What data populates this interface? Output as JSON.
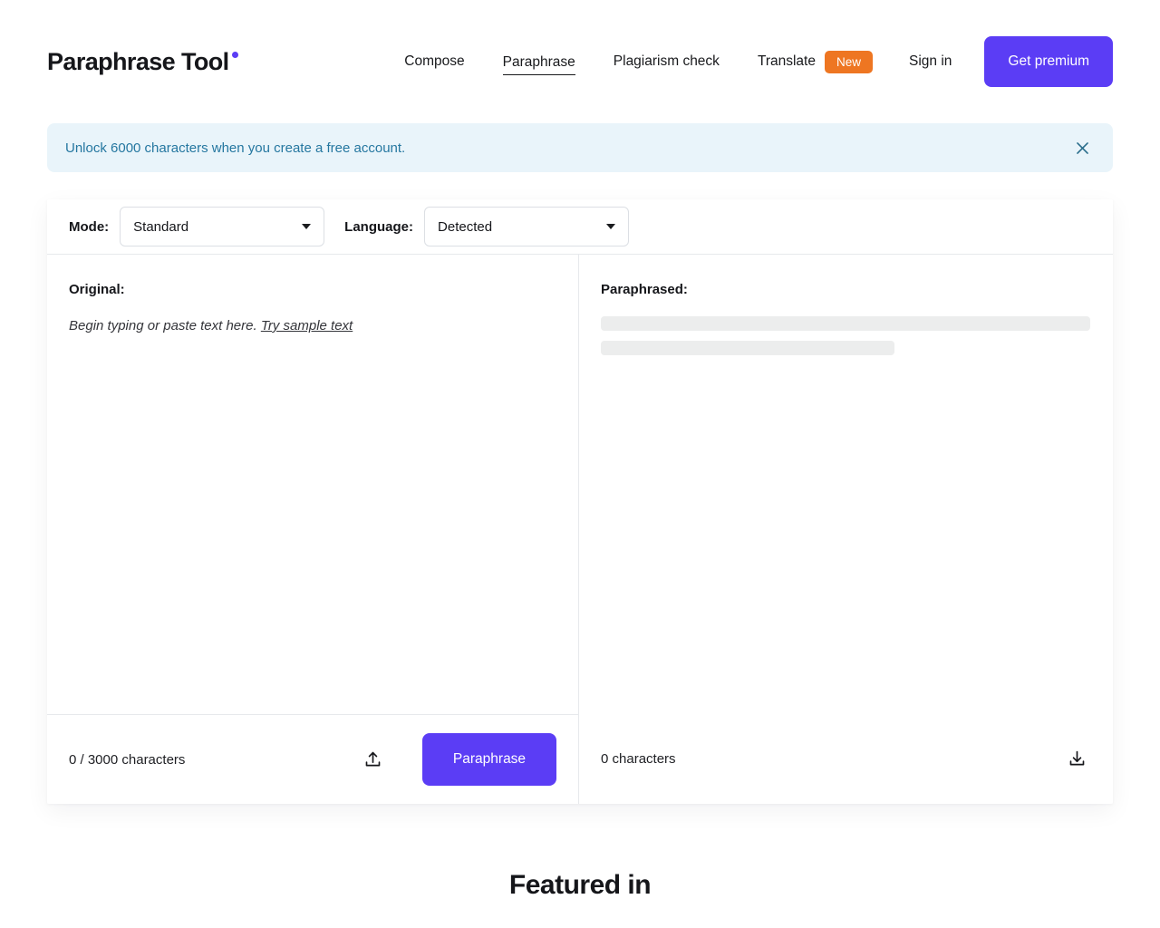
{
  "brand": {
    "name": "Paraphrase Tool",
    "dot_color": "#5b3df5"
  },
  "nav": {
    "items": [
      {
        "label": "Compose",
        "active": false
      },
      {
        "label": "Paraphrase",
        "active": true
      },
      {
        "label": "Plagiarism check",
        "active": false
      },
      {
        "label": "Translate",
        "active": false
      }
    ],
    "badge": "New",
    "badge_color": "#ee7622",
    "signin_label": "Sign in",
    "premium_label": "Get premium",
    "premium_color": "#5b3df5"
  },
  "banner": {
    "text": "Unlock 6000 characters when you create a free account.",
    "background": "#e9f4fa",
    "text_color": "#2577a0",
    "close_icon": "close-icon"
  },
  "controls": {
    "mode_label": "Mode:",
    "mode_value": "Standard",
    "language_label": "Language:",
    "language_value": "Detected"
  },
  "editor": {
    "original": {
      "title": "Original:",
      "placeholder": "Begin typing or paste text here.",
      "sample_link": "Try sample text",
      "char_count": "0 / 3000 characters",
      "upload_icon": "upload-icon",
      "action_label": "Paraphrase"
    },
    "paraphrased": {
      "title": "Paraphrased:",
      "char_count": "0 characters",
      "download_icon": "download-icon"
    }
  },
  "featured": {
    "title": "Featured in"
  }
}
